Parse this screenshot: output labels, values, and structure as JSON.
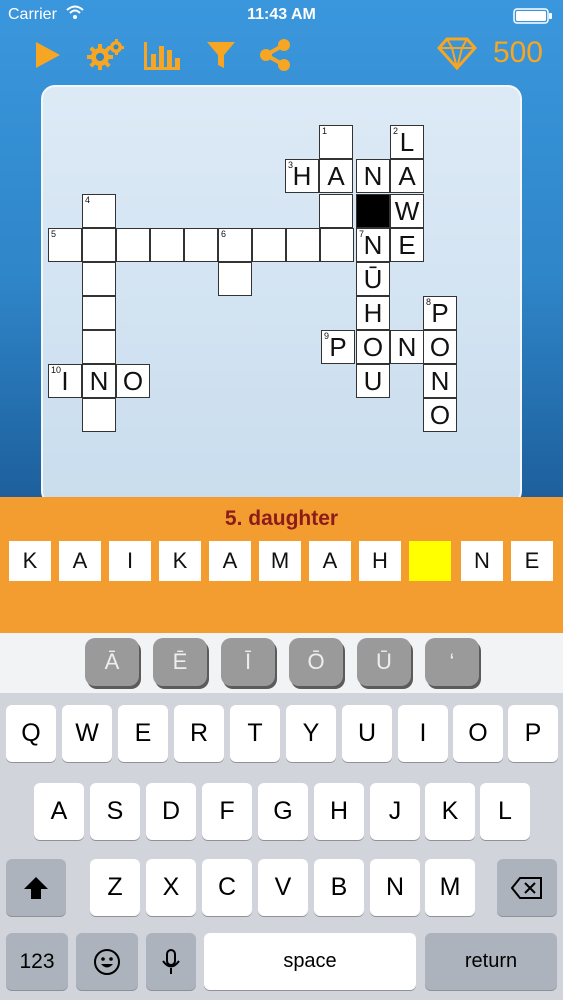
{
  "status": {
    "carrier": "Carrier",
    "time": "11:43 AM"
  },
  "toolbar": {
    "icons": [
      "play-icon",
      "settings-gears-icon",
      "stats-bar-chart-icon",
      "filter-icon",
      "share-icon"
    ],
    "gem_icon": "diamond-icon",
    "coins": "500"
  },
  "colors": {
    "accent_orange": "#f6a623",
    "clue_panel": "#f39c2f",
    "clue_text": "#8b1c1c",
    "active_cell": "#ffff00",
    "background_blue": "#2f86c9"
  },
  "crossword": {
    "numbers": [
      "1",
      "2",
      "3",
      "4",
      "5",
      "6",
      "7",
      "8",
      "9",
      "10"
    ],
    "across": {
      "hana": [
        "H",
        "A",
        "N",
        "A"
      ],
      "awe": [
        "W",
        "E"
      ],
      "pono": [
        "P",
        "O",
        "N",
        "O"
      ],
      "ino": [
        "I",
        "N",
        "O"
      ]
    },
    "down": {
      "lawe": [
        "L"
      ],
      "nuhou": [
        "N",
        "Ū",
        "H",
        "O",
        "U"
      ],
      "pono": [
        "O",
        "N",
        "O"
      ]
    }
  },
  "clue": {
    "text": "5. daughter",
    "answer": [
      "K",
      "A",
      "I",
      "K",
      "A",
      "M",
      "A",
      "H",
      "",
      "N",
      "E"
    ]
  },
  "keyboard": {
    "diacritics": [
      "Ā",
      "Ē",
      "Ī",
      "Ō",
      "Ū",
      "‘"
    ],
    "row1": [
      "Q",
      "W",
      "E",
      "R",
      "T",
      "Y",
      "U",
      "I",
      "O",
      "P"
    ],
    "row2": [
      "A",
      "S",
      "D",
      "F",
      "G",
      "H",
      "J",
      "K",
      "L"
    ],
    "row3": [
      "Z",
      "X",
      "C",
      "V",
      "B",
      "N",
      "M"
    ],
    "numbers_label": "123",
    "space_label": "space",
    "return_label": "return"
  }
}
